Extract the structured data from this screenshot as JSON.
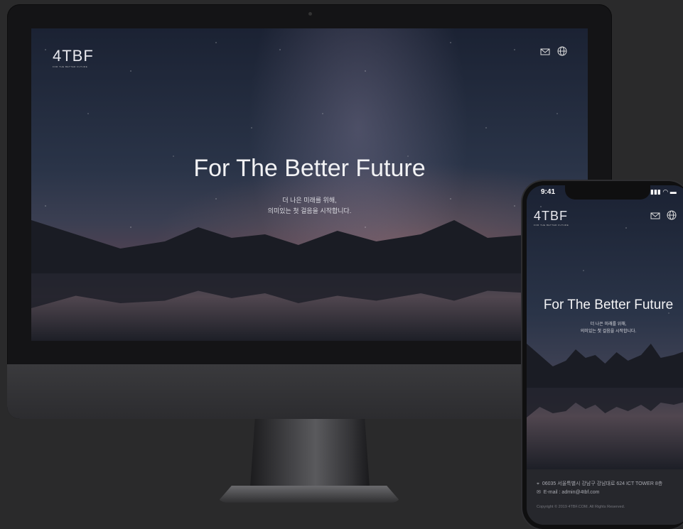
{
  "site": {
    "logo_text": "4TBF",
    "logo_subtext": "FOR THE BETTER FUTURE",
    "headline": "For The Better Future",
    "subline_1": "더 나은 미래를 위해,",
    "subline_2": "의미있는 첫 걸음을 시작합니다."
  },
  "icons": {
    "mail": "mail-icon",
    "globe": "globe-icon"
  },
  "phone": {
    "status_time": "9:41",
    "status_icons": "signal wifi battery",
    "footer": {
      "address": "06035 서울특별시 강남구 강남대로 624 ICT TOWER 8층",
      "email": "E-mail : admin@4tbf.com",
      "copyright": "Copyright © 2019 4TBF.COM. All Rights Reserved."
    }
  },
  "colors": {
    "page_background": "#2a2a2b",
    "sky": "#2a3448",
    "footer_bg": "#26272c"
  }
}
